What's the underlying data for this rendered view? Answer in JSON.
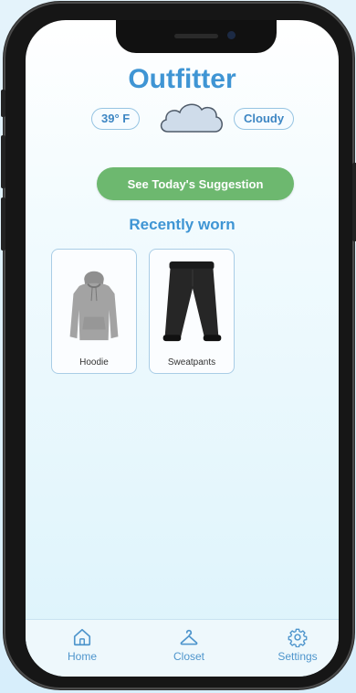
{
  "app": {
    "title": "Outfitter"
  },
  "weather": {
    "temperature": "39° F",
    "condition": "Cloudy",
    "icon": "cloud-icon"
  },
  "actions": {
    "suggestion_label": "See Today's Suggestion"
  },
  "recently_worn": {
    "heading": "Recently worn",
    "items": [
      {
        "label": "Hoodie",
        "icon": "hoodie-image"
      },
      {
        "label": "Sweatpants",
        "icon": "sweatpants-image"
      }
    ]
  },
  "tabs": [
    {
      "label": "Home",
      "icon": "home-icon"
    },
    {
      "label": "Closet",
      "icon": "hanger-icon"
    },
    {
      "label": "Settings",
      "icon": "gear-icon"
    }
  ],
  "colors": {
    "accent": "#3f95d4",
    "button": "#6db86f",
    "background": "#dcf3fb"
  }
}
